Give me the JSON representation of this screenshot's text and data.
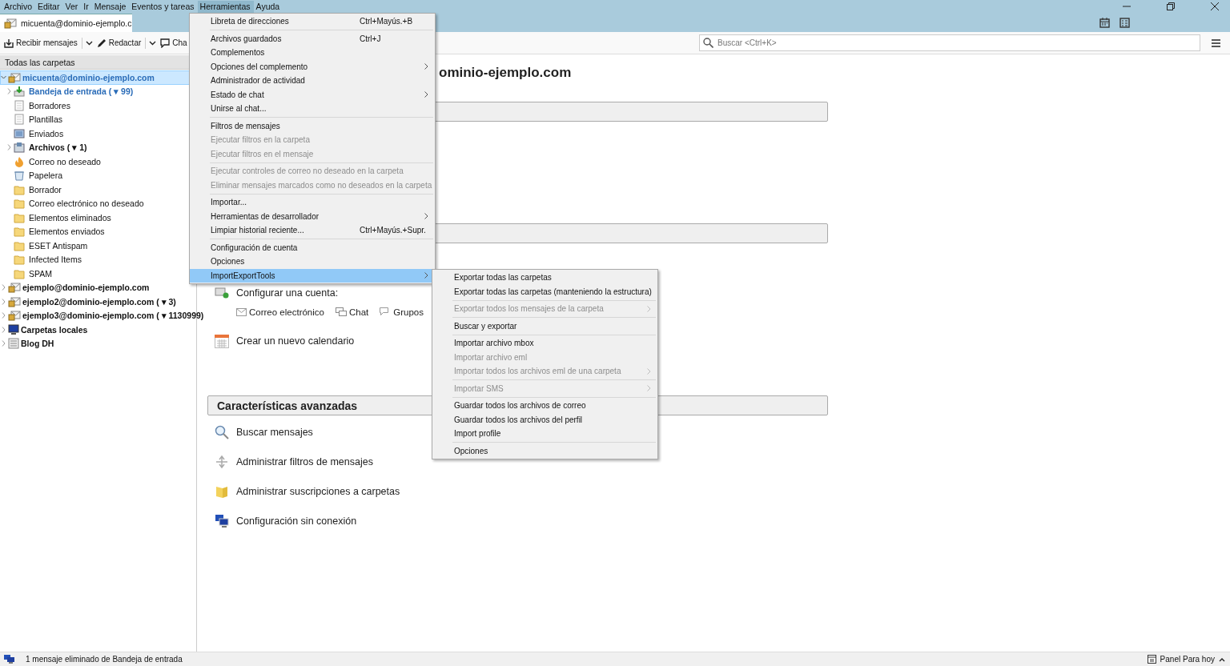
{
  "menubar": [
    {
      "label": "Archivo",
      "selected": false
    },
    {
      "label": "Editar",
      "selected": false
    },
    {
      "label": "Ver",
      "selected": false
    },
    {
      "label": "Ir",
      "selected": false
    },
    {
      "label": "Mensaje",
      "selected": false
    },
    {
      "label": "Eventos y tareas",
      "selected": false
    },
    {
      "label": "Herramientas",
      "selected": true
    },
    {
      "label": "Ayuda",
      "selected": false
    }
  ],
  "tab": {
    "label": "micuenta@dominio-ejemplo.c"
  },
  "toolbar": [
    {
      "label": "Recibir mensajes",
      "kind": "get",
      "dropdown": true
    },
    {
      "label": "Redactar",
      "kind": "write",
      "dropdown": true
    },
    {
      "label": "Cha",
      "kind": "chat"
    }
  ],
  "search": {
    "placeholder": "Buscar <Ctrl+K>"
  },
  "sidebar": {
    "header": "Todas las carpetas",
    "tree": [
      {
        "label": "micuenta@dominio-ejemplo.com",
        "kind": "account",
        "selected": true,
        "expanded": true,
        "unread": true,
        "new_mail": true,
        "children": [
          {
            "label": "Bandeja de entrada ( ▾ 99)",
            "kind": "inbox",
            "selected": false,
            "expanded": false,
            "unread": true,
            "new_mail": true
          },
          {
            "label": "Borradores",
            "kind": "draft",
            "selected": false,
            "unread": false,
            "new_mail": false
          },
          {
            "label": "Plantillas",
            "kind": "draft",
            "selected": false,
            "unread": false,
            "new_mail": false
          },
          {
            "label": "Enviados",
            "kind": "sent",
            "selected": false,
            "unread": false,
            "new_mail": false
          },
          {
            "label": "Archivos ( ▾ 1)",
            "kind": "archive",
            "selected": false,
            "expanded": false,
            "unread": true,
            "new_mail": false
          },
          {
            "label": "Correo no deseado",
            "kind": "junk",
            "selected": false,
            "unread": false,
            "new_mail": false
          },
          {
            "label": "Papelera",
            "kind": "trash",
            "selected": false,
            "unread": false,
            "new_mail": false
          },
          {
            "label": "Borrador",
            "kind": "folder",
            "selected": false,
            "unread": false,
            "new_mail": false
          },
          {
            "label": "Correo electrónico no deseado",
            "kind": "folder",
            "selected": false,
            "unread": false,
            "new_mail": false
          },
          {
            "label": "Elementos eliminados",
            "kind": "folder",
            "selected": false,
            "unread": false,
            "new_mail": false
          },
          {
            "label": "Elementos enviados",
            "kind": "folder",
            "selected": false,
            "unread": false,
            "new_mail": false
          },
          {
            "label": "ESET Antispam",
            "kind": "folder",
            "selected": false,
            "unread": false,
            "new_mail": false
          },
          {
            "label": "Infected Items",
            "kind": "folder",
            "selected": false,
            "unread": false,
            "new_mail": false
          },
          {
            "label": "SPAM",
            "kind": "folder",
            "selected": false,
            "unread": false,
            "new_mail": false
          }
        ]
      },
      {
        "label": "ejemplo@dominio-ejemplo.com",
        "kind": "account",
        "selected": false,
        "expanded": false,
        "unread": true,
        "new_mail": false
      },
      {
        "label": "ejemplo2@dominio-ejemplo.com ( ▾ 3)",
        "kind": "account",
        "selected": false,
        "expanded": false,
        "unread": true,
        "new_mail": false
      },
      {
        "label": "ejemplo3@dominio-ejemplo.com ( ▾ 1130999)",
        "kind": "account",
        "selected": false,
        "expanded": false,
        "unread": true,
        "new_mail": false
      },
      {
        "label": "Carpetas locales",
        "kind": "local",
        "selected": false,
        "expanded": false,
        "unread": true,
        "new_mail": false
      },
      {
        "label": "Blog DH",
        "kind": "blog",
        "selected": false,
        "expanded": false,
        "unread": true,
        "new_mail": false
      }
    ]
  },
  "main": {
    "title": "ominio-ejemplo.com",
    "setup": {
      "label": "Configurar una cuenta:",
      "options": [
        {
          "label": "Correo electrónico",
          "kind": "mail"
        },
        {
          "label": "Chat",
          "kind": "chat"
        },
        {
          "label": "Grupos",
          "kind": "groups"
        }
      ]
    },
    "calendar": "Crear un nuevo calendario",
    "advanced": {
      "title": "Características avanzadas",
      "items": [
        {
          "label": "Buscar mensajes",
          "kind": "search"
        },
        {
          "label": "Administrar filtros de mensajes",
          "kind": "filter"
        },
        {
          "label": "Administrar suscripciones a carpetas",
          "kind": "folder"
        },
        {
          "label": "Configuración sin conexión",
          "kind": "offline"
        }
      ]
    }
  },
  "menu": {
    "items": [
      {
        "label": "Libreta de direcciones",
        "shortcut": "Ctrl+Mayús.+B",
        "disabled": false,
        "submenu": false,
        "selected": false
      },
      {
        "kind": "separator"
      },
      {
        "label": "Archivos guardados",
        "shortcut": "Ctrl+J",
        "disabled": false,
        "submenu": false,
        "selected": false
      },
      {
        "label": "Complementos",
        "disabled": false,
        "submenu": false,
        "selected": false
      },
      {
        "label": "Opciones del complemento",
        "disabled": false,
        "submenu": true,
        "selected": false
      },
      {
        "label": "Administrador de actividad",
        "disabled": false,
        "submenu": false,
        "selected": false
      },
      {
        "label": "Estado de chat",
        "disabled": false,
        "submenu": true,
        "selected": false
      },
      {
        "label": "Unirse al chat...",
        "disabled": false,
        "submenu": false,
        "selected": false
      },
      {
        "kind": "separator"
      },
      {
        "label": "Filtros de mensajes",
        "disabled": false,
        "submenu": false,
        "selected": false
      },
      {
        "label": "Ejecutar filtros en la carpeta",
        "disabled": true,
        "submenu": false,
        "selected": false
      },
      {
        "label": "Ejecutar filtros en el mensaje",
        "disabled": true,
        "submenu": false,
        "selected": false
      },
      {
        "kind": "separator"
      },
      {
        "label": "Ejecutar controles de correo no deseado en la carpeta",
        "disabled": true,
        "submenu": false,
        "selected": false
      },
      {
        "label": "Eliminar mensajes marcados como no deseados en la carpeta",
        "disabled": true,
        "submenu": false,
        "selected": false
      },
      {
        "kind": "separator"
      },
      {
        "label": "Importar...",
        "disabled": false,
        "submenu": false,
        "selected": false
      },
      {
        "label": "Herramientas de desarrollador",
        "disabled": false,
        "submenu": true,
        "selected": false
      },
      {
        "label": "Limpiar historial reciente...",
        "shortcut": "Ctrl+Mayús.+Supr.",
        "disabled": false,
        "submenu": false,
        "selected": false
      },
      {
        "kind": "separator"
      },
      {
        "label": "Configuración de cuenta",
        "disabled": false,
        "submenu": false,
        "selected": false
      },
      {
        "label": "Opciones",
        "disabled": false,
        "submenu": false,
        "selected": false
      },
      {
        "label": "ImportExportTools",
        "disabled": false,
        "submenu": true,
        "selected": true
      }
    ]
  },
  "submenu": {
    "items": [
      {
        "label": "Exportar todas las carpetas",
        "disabled": false,
        "submenu": false
      },
      {
        "label": "Exportar todas las carpetas (manteniendo la estructura)",
        "disabled": false,
        "submenu": false
      },
      {
        "kind": "separator"
      },
      {
        "label": "Exportar todos los mensajes de la carpeta",
        "disabled": true,
        "submenu": true
      },
      {
        "kind": "separator"
      },
      {
        "label": "Buscar y exportar",
        "disabled": false,
        "submenu": false
      },
      {
        "kind": "separator"
      },
      {
        "label": "Importar archivo mbox",
        "disabled": false,
        "submenu": false
      },
      {
        "label": "Importar archivo eml",
        "disabled": true,
        "submenu": false
      },
      {
        "label": "Importar todos los archivos eml de una carpeta",
        "disabled": true,
        "submenu": true
      },
      {
        "kind": "separator"
      },
      {
        "label": "Importar SMS",
        "disabled": true,
        "submenu": true
      },
      {
        "kind": "separator"
      },
      {
        "label": "Guardar todos los archivos de correo",
        "disabled": false,
        "submenu": false
      },
      {
        "label": "Guardar todos los archivos del perfil",
        "disabled": false,
        "submenu": false
      },
      {
        "label": "Import profile",
        "disabled": false,
        "submenu": false
      },
      {
        "kind": "separator"
      },
      {
        "label": "Opciones",
        "disabled": false,
        "submenu": false
      }
    ]
  },
  "status": {
    "text": "1 mensaje eliminado de Bandeja de entrada",
    "today": "Panel Para hoy"
  }
}
